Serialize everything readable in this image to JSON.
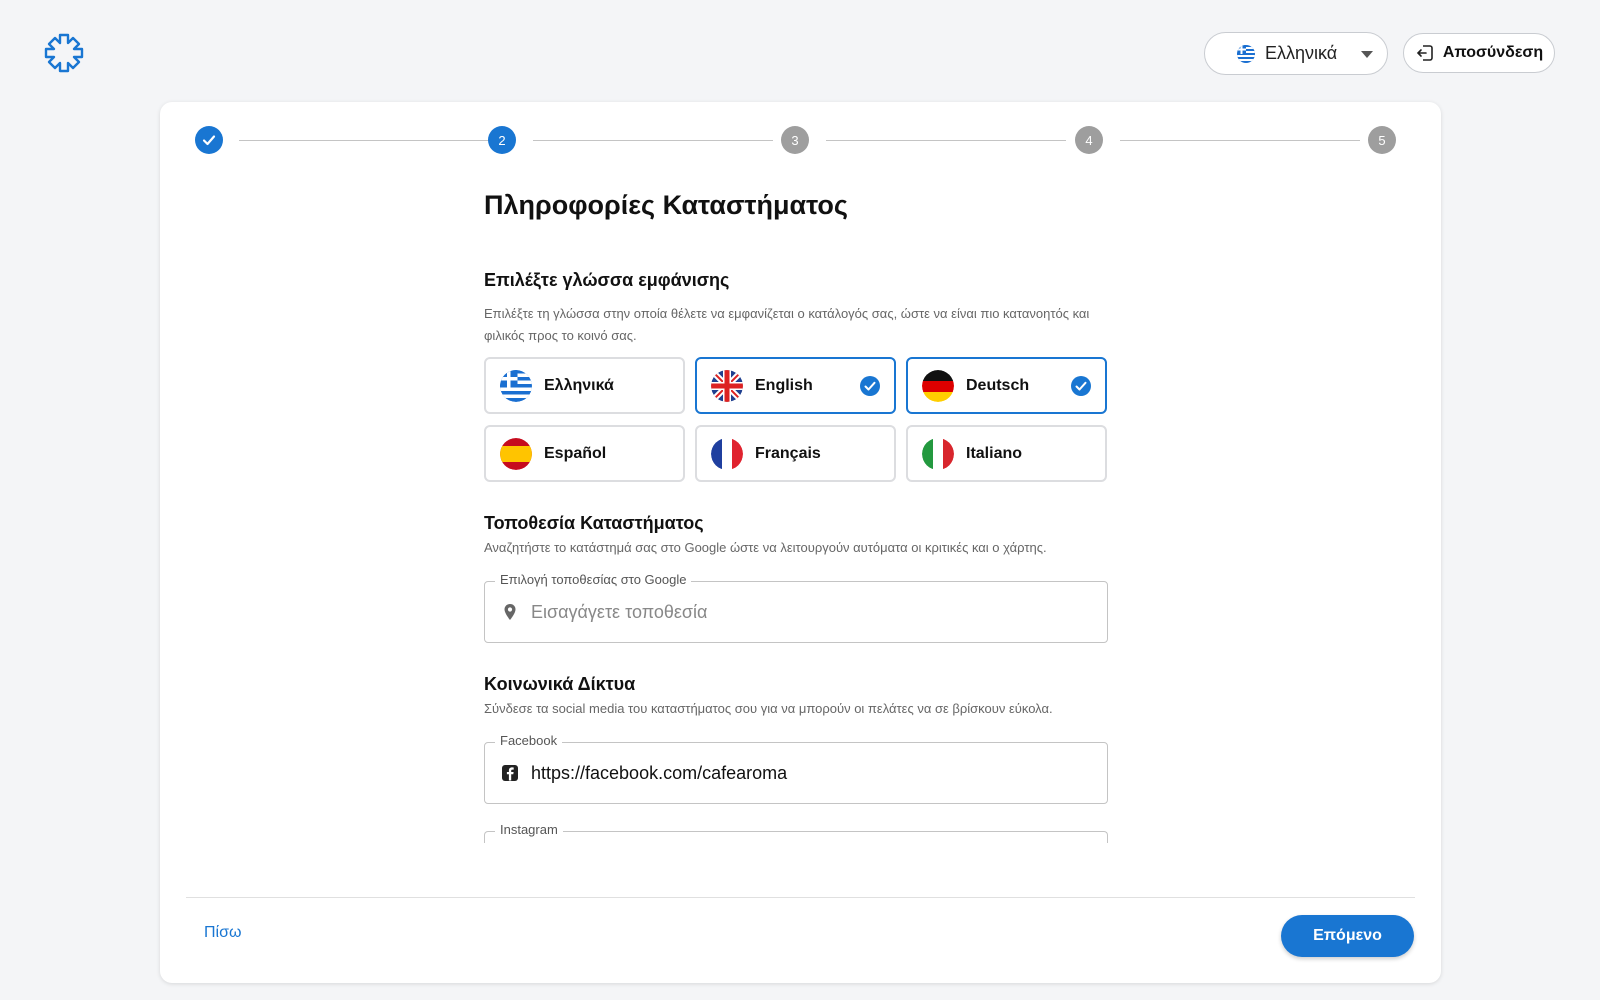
{
  "header": {
    "language_selector": {
      "value": "Ελληνικά"
    },
    "logout_label": "Αποσύνδεση"
  },
  "stepper": {
    "steps": [
      {
        "label": "",
        "state": "done"
      },
      {
        "label": "2",
        "state": "active"
      },
      {
        "label": "3",
        "state": "pending"
      },
      {
        "label": "4",
        "state": "pending"
      },
      {
        "label": "5",
        "state": "pending"
      }
    ]
  },
  "main": {
    "title": "Πληροφορίες Καταστήματος",
    "language_section": {
      "title": "Επιλέξτε γλώσσα εμφάνισης",
      "description": "Επιλέξτε τη γλώσσα στην οποία θέλετε να εμφανίζεται ο κατάλογός σας, ώστε να είναι πιο κατανοητός και φιλικός προς το κοινό σας.",
      "languages": [
        {
          "label": "Ελληνικά",
          "flag": "greece-flag-icon",
          "selected": false
        },
        {
          "label": "English",
          "flag": "uk-flag-icon",
          "selected": true
        },
        {
          "label": "Deutsch",
          "flag": "germany-flag-icon",
          "selected": true
        },
        {
          "label": "Español",
          "flag": "spain-flag-icon",
          "selected": false
        },
        {
          "label": "Français",
          "flag": "france-flag-icon",
          "selected": false
        },
        {
          "label": "Italiano",
          "flag": "italy-flag-icon",
          "selected": false
        }
      ]
    },
    "location_section": {
      "title": "Τοποθεσία Καταστήματος",
      "description": "Αναζητήστε το κατάστημά σας στο Google ώστε να λειτουργούν αυτόματα οι κριτικές και ο χάρτης.",
      "field_label": "Επιλογή τοποθεσίας στο Google",
      "placeholder": "Εισαγάγετε τοποθεσία",
      "value": ""
    },
    "social_section": {
      "title": "Κοινωνικά Δίκτυα",
      "description": "Σύνδεσε τα social media του καταστήματος σου για να μπορούν οι πελάτες να σε βρίσκουν εύκολα.",
      "facebook": {
        "label": "Facebook",
        "value": "https://facebook.com/cafearoma"
      },
      "instagram": {
        "label": "Instagram"
      }
    }
  },
  "footer": {
    "back_label": "Πίσω",
    "next_label": "Επόμενο"
  },
  "colors": {
    "primary": "#1976d2",
    "pending_step": "#9e9e9e"
  }
}
